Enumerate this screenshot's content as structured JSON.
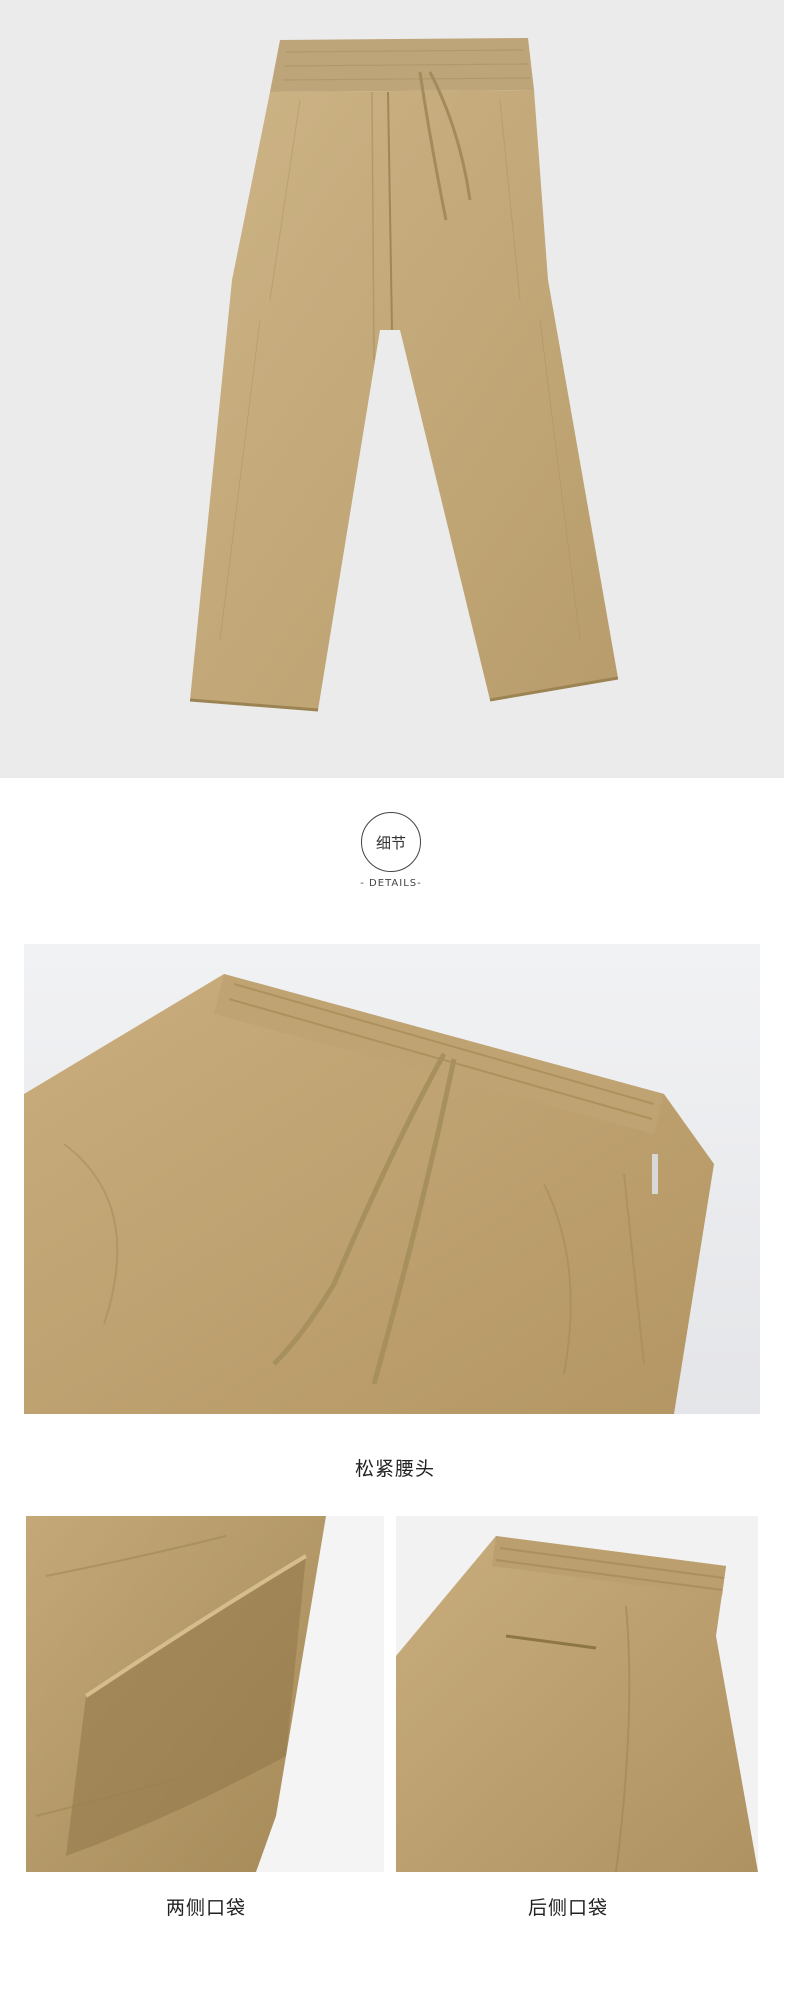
{
  "details_badge": {
    "label": "细节",
    "sub": "- DETAILS-"
  },
  "captions": {
    "waist": "松紧腰头",
    "side_pockets": "两侧口袋",
    "back_pocket": "后侧口袋"
  },
  "colors": {
    "khaki": "#c5aa7d",
    "khaki_dark": "#a8915f",
    "backdrop": "#ebebeb"
  }
}
